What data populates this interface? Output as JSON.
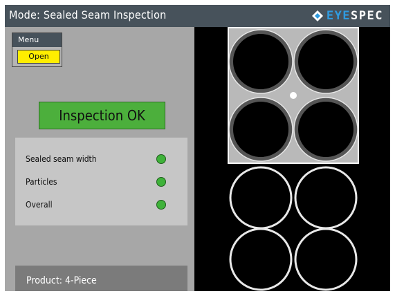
{
  "header": {
    "mode_title": "Mode:  Sealed Seam Inspection",
    "logo_eye": "EYE",
    "logo_spec": "SPEC"
  },
  "menu": {
    "title": "Menu",
    "open_label": "Open"
  },
  "status": {
    "text": "Inspection  OK",
    "color": "#4caf3c"
  },
  "results": [
    {
      "label": "Sealed seam width",
      "status": "ok",
      "color": "#3fb23a"
    },
    {
      "label": "Particles",
      "status": "ok",
      "color": "#3fb23a"
    },
    {
      "label": "Overall",
      "status": "ok",
      "color": "#3fb23a"
    }
  ],
  "product": {
    "label": "Product: 4-Piece"
  },
  "colors": {
    "titlebar": "#47525b",
    "accent_logo": "#2f9be0",
    "open_button": "#ffee00",
    "panel": "#a7a7a7"
  }
}
